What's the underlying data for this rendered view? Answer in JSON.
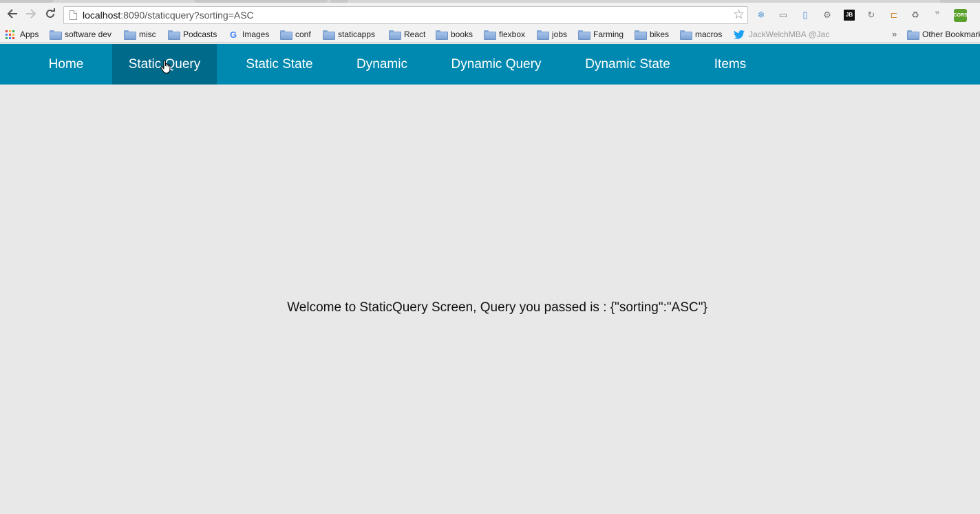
{
  "browser": {
    "url_host": "localhost",
    "url_rest": ":8090/staticquery?sorting=ASC",
    "icons": {
      "back": "back-arrow-icon",
      "forward": "forward-arrow-icon",
      "reload": "reload-icon",
      "page": "page-icon",
      "bookmark_star": "star-icon"
    },
    "extensions": [
      {
        "name": "snowflake-extension-icon",
        "glyph": "❄"
      },
      {
        "name": "cast-icon",
        "glyph": "▭"
      },
      {
        "name": "docs-extension-icon",
        "glyph": "▯"
      },
      {
        "name": "tool-extension-icon",
        "glyph": "⚙"
      },
      {
        "name": "jetbrains-icon",
        "glyph": "JB"
      },
      {
        "name": "sync-extension-icon",
        "glyph": "↻"
      },
      {
        "name": "ruler-extension-icon",
        "glyph": "⊏"
      },
      {
        "name": "recycle-extension-icon",
        "glyph": "♻"
      },
      {
        "name": "quote-extension-icon",
        "glyph": "❞"
      },
      {
        "name": "cors-extension-icon",
        "glyph": "CORS"
      }
    ]
  },
  "bookmarks": {
    "items": [
      {
        "label": "Apps",
        "icon": "apps-grid-icon"
      },
      {
        "label": "software dev",
        "icon": "folder-icon"
      },
      {
        "label": "misc",
        "icon": "folder-icon"
      },
      {
        "label": "Podcasts",
        "icon": "folder-icon"
      },
      {
        "label": "Images",
        "icon": "google-icon"
      },
      {
        "label": "conf",
        "icon": "folder-icon"
      },
      {
        "label": "staticapps",
        "icon": "folder-icon"
      },
      {
        "label": "React",
        "icon": "folder-icon"
      },
      {
        "label": "books",
        "icon": "folder-icon"
      },
      {
        "label": "flexbox",
        "icon": "folder-icon"
      },
      {
        "label": "jobs",
        "icon": "folder-icon"
      },
      {
        "label": "Farming",
        "icon": "folder-icon"
      },
      {
        "label": "bikes",
        "icon": "folder-icon"
      },
      {
        "label": "macros",
        "icon": "folder-icon"
      },
      {
        "label": "JackWelchMBA @Jac",
        "icon": "twitter-icon"
      }
    ],
    "overflow": "»",
    "other": "Other Bookmarks"
  },
  "nav": {
    "items": [
      {
        "label": "Home"
      },
      {
        "label": "Static Query"
      },
      {
        "label": "Static State"
      },
      {
        "label": "Dynamic"
      },
      {
        "label": "Dynamic Query"
      },
      {
        "label": "Dynamic State"
      },
      {
        "label": "Items"
      }
    ],
    "active": "Static Query"
  },
  "main": {
    "message": "Welcome to StaticQuery Screen, Query you passed is : {\"sorting\":\"ASC\"}"
  },
  "colors": {
    "nav_bg": "#0089b0",
    "nav_active_bg": "#006a8a",
    "page_bg": "#e8e8e8",
    "twitter_blue": "#1da1f2",
    "cors_green": "#5aa02c"
  }
}
